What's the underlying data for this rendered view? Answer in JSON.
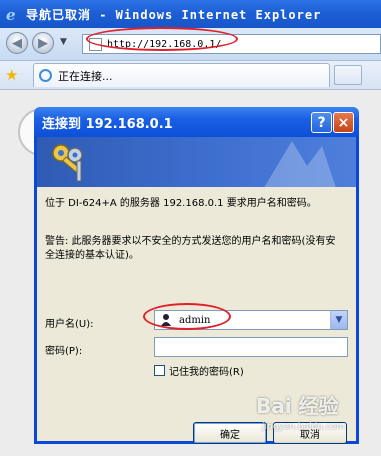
{
  "window": {
    "title": "导航已取消 - Windows Internet Explorer",
    "url": "http://192.168.0.1/",
    "tab_label": "正在连接..."
  },
  "dialog": {
    "title": "连接到 192.168.0.1",
    "message1": "位于 DI-624+A 的服务器 192.168.0.1 要求用户名和密码。",
    "message2": "警告: 此服务器要求以不安全的方式发送您的用户名和密码(没有安全连接的基本认证)。",
    "username_label": "用户名(U):",
    "username_value": "admin",
    "password_label": "密码(P):",
    "password_value": "",
    "remember_label": "记住我的密码(R)",
    "ok_label": "确定",
    "cancel_label": "取消",
    "help_symbol": "?",
    "close_symbol": "×"
  },
  "watermark": {
    "brand": "Bai 经验",
    "site": "jingyan.baidu.com"
  },
  "colors": {
    "xp_title_blue": "#0a49d6",
    "dialog_body": "#ece9d8",
    "annotation_red": "#e0202a"
  }
}
